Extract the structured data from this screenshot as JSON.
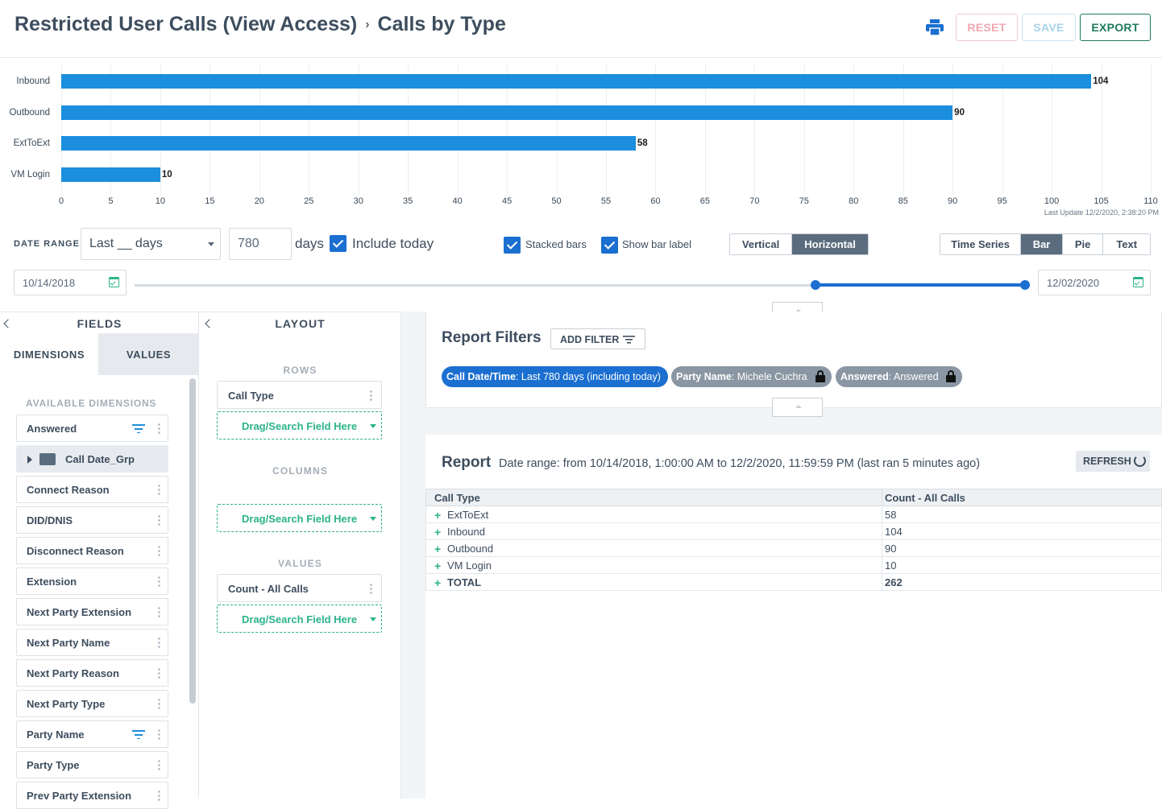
{
  "header": {
    "title_main": "Restricted User Calls (View Access)",
    "breadcrumb_sep": "›",
    "title_sub": "Calls by Type",
    "reset_label": "RESET",
    "save_label": "SAVE",
    "export_label": "EXPORT"
  },
  "chart_data": {
    "type": "bar",
    "orientation": "horizontal",
    "categories": [
      "Inbound",
      "Outbound",
      "ExtToExt",
      "VM Login"
    ],
    "values": [
      104,
      90,
      58,
      10
    ],
    "xlim": [
      0,
      110
    ],
    "xticks": [
      "0",
      "5",
      "10",
      "15",
      "20",
      "25",
      "30",
      "35",
      "40",
      "45",
      "50",
      "55",
      "60",
      "65",
      "70",
      "75",
      "80",
      "85",
      "90",
      "95",
      "100",
      "105",
      "110"
    ],
    "data_labels": [
      "104",
      "90",
      "58",
      "10"
    ],
    "color": "#1b8ede",
    "grid": true
  },
  "last_update": "Last Update 12/2/2020, 2:38:20 PM",
  "controls": {
    "date_range_label": "DATE RANGE",
    "range_select": "Last __ days",
    "days_value": "780",
    "days_label": "days",
    "include_today_label": "Include today",
    "include_today_checked": true,
    "stacked_bars_label": "Stacked bars",
    "show_bar_label": "Show bar label",
    "orientation_options": [
      "Vertical",
      "Horizontal"
    ],
    "orientation_selected": "Horizontal",
    "chart_types": [
      "Time Series",
      "Bar",
      "Pie",
      "Text"
    ],
    "chart_type_selected": "Bar",
    "date_from": "10/14/2018",
    "date_to": "12/02/2020"
  },
  "fields_panel": {
    "title": "FIELDS",
    "tab_dimensions": "DIMENSIONS",
    "tab_values": "VALUES",
    "available_label": "AVAILABLE DIMENSIONS",
    "items": [
      {
        "label": "Answered",
        "filtered": true
      },
      {
        "label": "Call Date_Grp",
        "group": true
      },
      {
        "label": "Connect Reason"
      },
      {
        "label": "DID/DNIS"
      },
      {
        "label": "Disconnect Reason"
      },
      {
        "label": "Extension"
      },
      {
        "label": "Next Party Extension"
      },
      {
        "label": "Next Party Name"
      },
      {
        "label": "Next Party Reason"
      },
      {
        "label": "Next Party Type"
      },
      {
        "label": "Party Name",
        "filtered": true
      },
      {
        "label": "Party Type"
      },
      {
        "label": "Prev Party Extension"
      }
    ]
  },
  "layout_panel": {
    "title": "LAYOUT",
    "rows_label": "ROWS",
    "row_field": "Call Type",
    "columns_label": "COLUMNS",
    "values_label": "VALUES",
    "value_field": "Count - All Calls",
    "drop_placeholder": "Drag/Search Field Here"
  },
  "report_filters": {
    "title": "Report Filters",
    "add_filter_label": "ADD FILTER",
    "chips": [
      {
        "key": "Call Date/Time",
        "value": ": Last 780 days (including today)",
        "color": "#1b6fd0",
        "locked": false
      },
      {
        "key": "Party Name",
        "value": ": Michele Cuchra",
        "color": "#8a96a3",
        "locked": true
      },
      {
        "key": "Answered",
        "value": ": Answered",
        "color": "#8a96a3",
        "locked": true
      }
    ]
  },
  "report": {
    "title": "Report",
    "range_text": "Date range: from 10/14/2018, 1:00:00 AM to 12/2/2020, 11:59:59 PM (last ran 5 minutes ago)",
    "refresh_label": "REFRESH",
    "columns": [
      "Call Type",
      "Count - All Calls"
    ],
    "rows": [
      [
        "ExtToExt",
        "58"
      ],
      [
        "Inbound",
        "104"
      ],
      [
        "Outbound",
        "90"
      ],
      [
        "VM Login",
        "10"
      ],
      [
        "TOTAL",
        "262"
      ]
    ]
  }
}
